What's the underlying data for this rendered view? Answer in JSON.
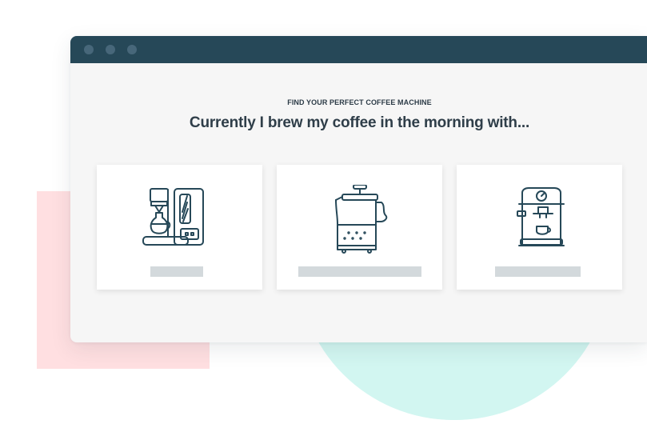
{
  "window": {
    "controls": [
      "close",
      "minimize",
      "maximize"
    ]
  },
  "quiz": {
    "eyebrow": "FIND YOUR PERFECT COFFEE MACHINE",
    "question": "Currently I brew my coffee in the morning with...",
    "options": [
      {
        "icon": "drip-coffee-maker-icon"
      },
      {
        "icon": "french-press-icon"
      },
      {
        "icon": "espresso-machine-icon"
      }
    ]
  },
  "colors": {
    "titlebar": "#264858",
    "window_control": "#47677a",
    "icon_stroke": "#264858",
    "placeholder_bar": "#d3d9dc",
    "decor_pink": "#ffdfe1",
    "decor_mint": "#d2f6f1"
  }
}
